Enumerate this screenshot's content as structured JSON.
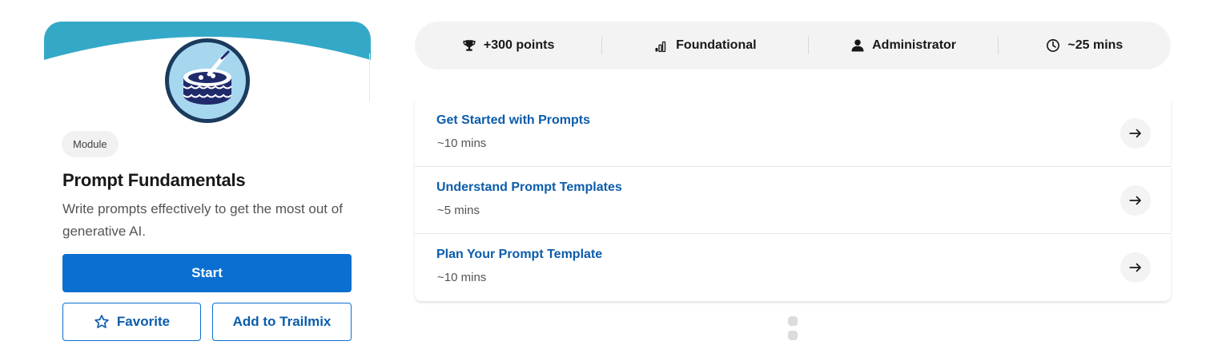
{
  "module": {
    "type_label": "Module",
    "title": "Prompt Fundamentals",
    "description": "Write prompts effectively to get the most out of generative AI.",
    "start_label": "Start",
    "favorite_label": "Favorite",
    "trailmix_label": "Add to Trailmix"
  },
  "stats": {
    "points": "+300 points",
    "level": "Foundational",
    "role": "Administrator",
    "duration": "~25 mins"
  },
  "units": [
    {
      "title": "Get Started with Prompts",
      "time": "~10 mins"
    },
    {
      "title": "Understand Prompt Templates",
      "time": "~5 mins"
    },
    {
      "title": "Plan Your Prompt Template",
      "time": "~10 mins"
    }
  ],
  "icons": {
    "trophy": "trophy-icon",
    "level": "signal-bars-icon",
    "role": "person-icon",
    "clock": "clock-icon",
    "star": "star-icon",
    "arrow": "arrow-right-icon"
  },
  "colors": {
    "banner": "#34a9c7",
    "primary": "#0b6fd1",
    "link": "#0b5cab",
    "badge_bg": "#a7d6ef",
    "badge_ring": "#1a3b5d"
  }
}
